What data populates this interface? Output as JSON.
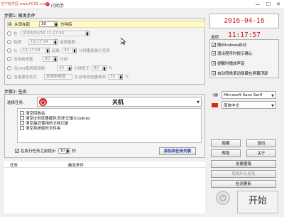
{
  "window": {
    "watermark": "当下软件园 www.PC6Z.com",
    "title": "闪助手",
    "min": "—",
    "max": "☐",
    "close": "✕"
  },
  "step1": {
    "title": "步骤1: 触发条件",
    "row1": {
      "label": "从现在起",
      "value": "30",
      "unit": "分钟后"
    },
    "row2": {
      "label": "在",
      "value": "2016/04/16  11:17:34"
    },
    "row3": {
      "label": "每周",
      "value": "11:17:34",
      "extra": "选择星期..."
    },
    "row4": {
      "label": "从",
      "value": "11:17:34",
      "mid": "起每",
      "value2": "30",
      "unit": "分钟重新执行任务"
    },
    "row5": {
      "label": "当系统闲置",
      "value": "30",
      "unit": "分钟"
    },
    "row6": {
      "label": "当CPU使用率持续",
      "value": "30",
      "mid": "分钟低于",
      "value2": "80",
      "unit": "%"
    },
    "row7": {
      "label": "当电源状态为",
      "value": "未使用电源",
      "mid": "并且电池电量低到",
      "value2": "30",
      "unit": "%"
    }
  },
  "clock": {
    "text": "2016-04-16 11:17:57"
  },
  "options": {
    "title": "选项",
    "items": [
      {
        "label": "随Windows启动",
        "checked": "✓"
      },
      {
        "label": "退出程序时提示确认",
        "checked": "✓"
      },
      {
        "label": "提醒时播放声音",
        "checked": "✓"
      },
      {
        "label": "自动转换滚动隐藏在屏幕顶部",
        "checked": "✓"
      }
    ]
  },
  "font_select": {
    "value": "Microsoft Sans Serif"
  },
  "lang_select": {
    "value": "简体中文"
  },
  "step2": {
    "title": "步骤2: 任务",
    "select_label": "选择任务:",
    "selected_task": "关机",
    "list_items": [
      "清空回收站",
      "清空IE浏览器缓存/历史记录/Cookies",
      "清空最近使用的文档记录",
      "清空系统临时文件夹"
    ],
    "prompt_label": "在执行任务之前提示",
    "prompt_value": "10",
    "prompt_unit": "秒",
    "add_button": "添加到任务列表"
  },
  "side_buttons": {
    "hide": "隐藏",
    "exit": "退出",
    "help": "帮助",
    "about": "关于",
    "create_note": "创建便笺",
    "hide_all_notes": "隐藏所有便笺",
    "check_update": "检测更新"
  },
  "table": {
    "col_task": "任务",
    "col_trigger": "触发条件"
  },
  "start": {
    "label": "开始"
  },
  "colors": {
    "accent": "#2a6ad8",
    "clock": "#d01818",
    "power_icon": "#d02020"
  }
}
